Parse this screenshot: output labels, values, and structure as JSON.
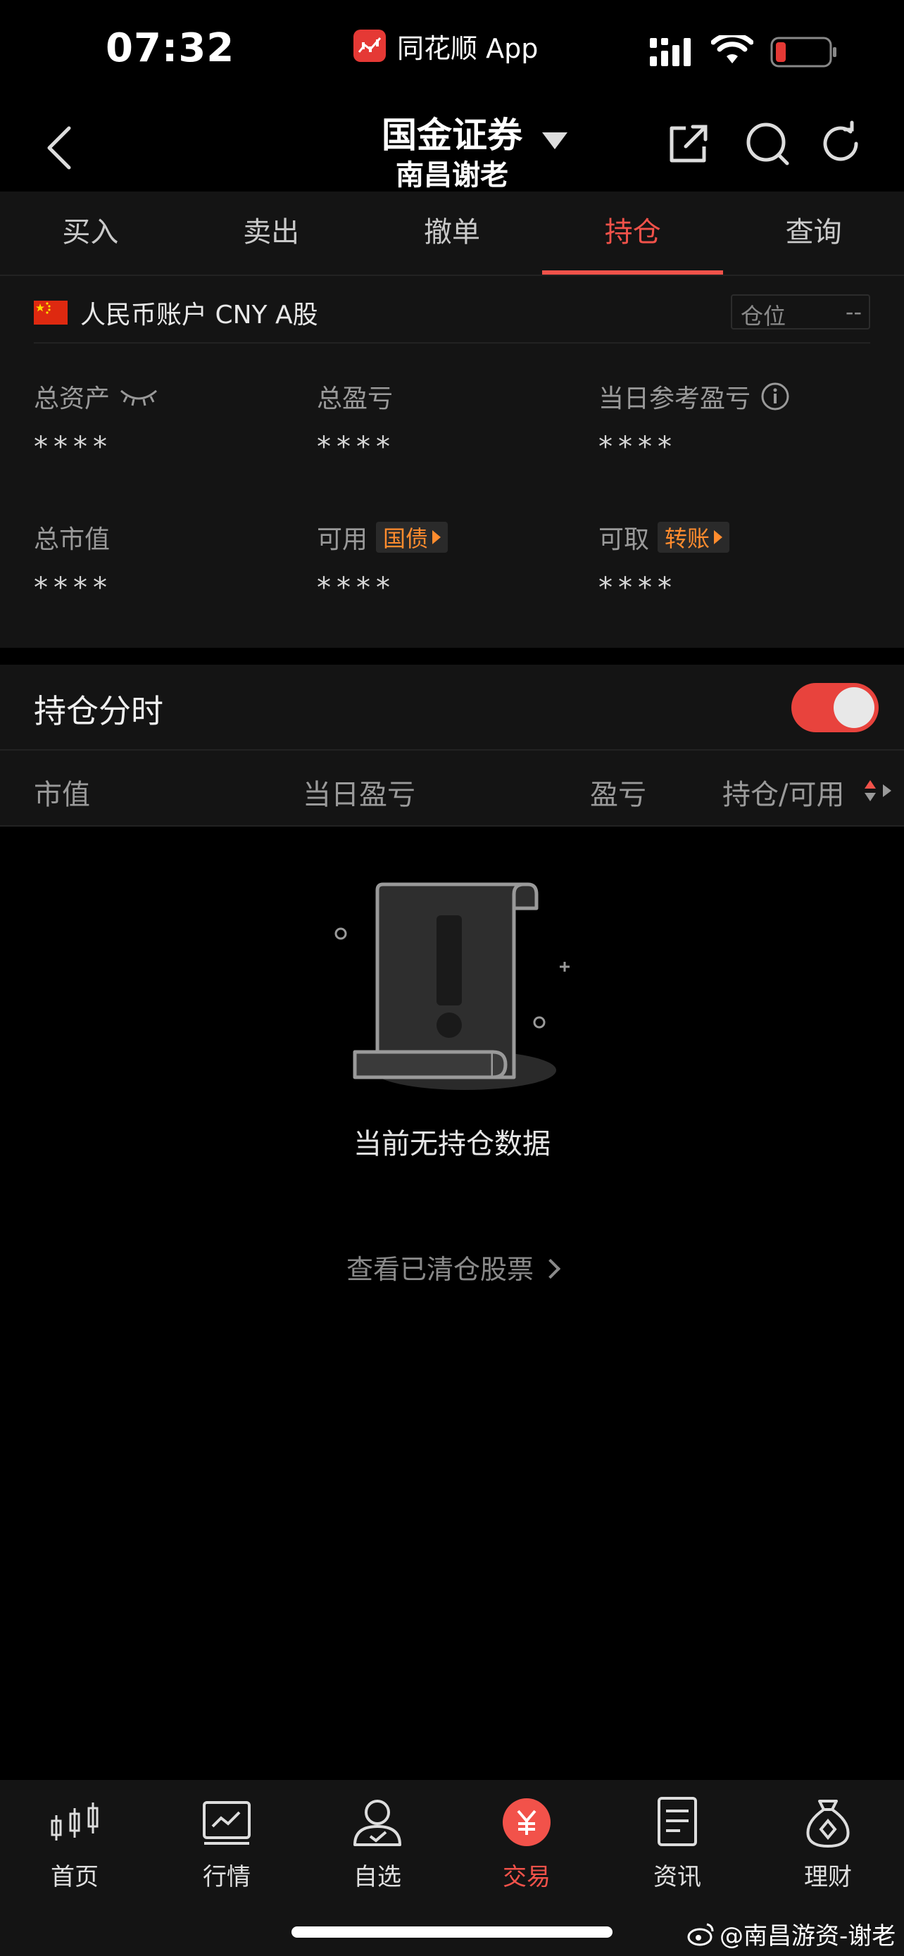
{
  "status_bar": {
    "time": "07:32",
    "app_name": "同花顺 App"
  },
  "header": {
    "broker": "国金证券",
    "account": "南昌谢老"
  },
  "tabs": [
    {
      "label": "买入"
    },
    {
      "label": "卖出"
    },
    {
      "label": "撤单"
    },
    {
      "label": "持仓",
      "active": true
    },
    {
      "label": "查询"
    }
  ],
  "account": {
    "label": "人民币账户 CNY A股",
    "position_label": "仓位",
    "position_value": "--"
  },
  "metrics": {
    "total_assets": {
      "label": "总资产",
      "value": "****"
    },
    "total_pnl": {
      "label": "总盈亏",
      "value": "****"
    },
    "daily_pnl": {
      "label": "当日参考盈亏",
      "value": "****"
    },
    "market_value": {
      "label": "总市值",
      "value": "****"
    },
    "available": {
      "label": "可用",
      "tag": "国债",
      "value": "****"
    },
    "withdrawable": {
      "label": "可取",
      "tag": "转账",
      "value": "****"
    }
  },
  "holdings": {
    "title": "持仓分时",
    "toggle_on": true,
    "columns": [
      "市值",
      "当日盈亏",
      "盈亏",
      "持仓/可用"
    ]
  },
  "empty_state": {
    "message": "当前无持仓数据",
    "cleared_link": "查看已清仓股票"
  },
  "bottom_nav": [
    {
      "label": "首页",
      "icon": "candlestick-icon"
    },
    {
      "label": "行情",
      "icon": "chart-icon"
    },
    {
      "label": "自选",
      "icon": "user-icon"
    },
    {
      "label": "交易",
      "icon": "yuan-icon",
      "active": true
    },
    {
      "label": "资讯",
      "icon": "document-icon"
    },
    {
      "label": "理财",
      "icon": "money-bag-icon"
    }
  ],
  "watermark": "@南昌游资-谢老",
  "colors": {
    "accent": "#f2524a",
    "tag": "#ff8c2e",
    "background": "#000000",
    "surface": "#141414"
  }
}
